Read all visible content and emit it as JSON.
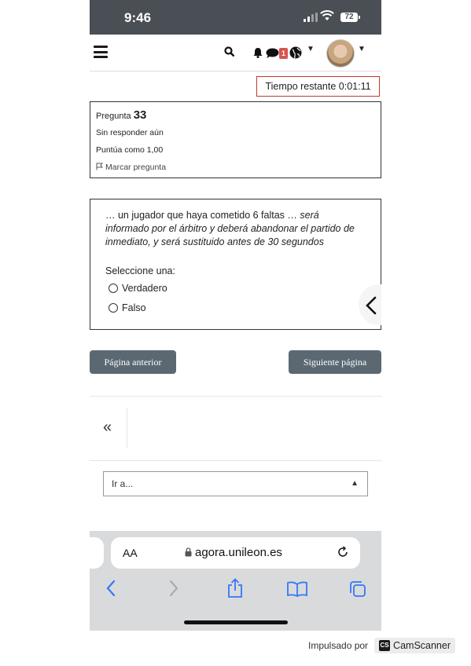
{
  "status_bar": {
    "time": "9:46",
    "battery": "72"
  },
  "timer": {
    "label": "Tiempo restante 0:01:11"
  },
  "question_info": {
    "number_prefix": "Pregunta",
    "number": "33",
    "state": "Sin responder aún",
    "grade": "Puntúa como 1,00",
    "flag_label": "Marcar pregunta"
  },
  "question": {
    "text_plain": "… un jugador que haya cometido 6 faltas …",
    "text_italic": "será informado por el árbitro y deberá abandonar el partido de inmediato, y será sustituido antes de 30 segundos",
    "prompt": "Seleccione una:",
    "options": [
      "Verdadero",
      "Falso"
    ]
  },
  "navigation": {
    "prev_label": "Página anterior",
    "next_label": "Siguiente página",
    "pager_first": "«",
    "jump_placeholder": "Ir a..."
  },
  "safari": {
    "text_size": "AA",
    "url": "agora.unileon.es"
  },
  "notifications": {
    "badge_count": "1"
  },
  "footer": {
    "powered_by": "Impulsado por",
    "brand": "CamScanner",
    "brand_logo": "CS"
  },
  "colors": {
    "button_bg": "#5b6872",
    "timer_border": "#c0392b",
    "safari_blue": "#3478f6",
    "status_bar": "#4a4f55"
  }
}
